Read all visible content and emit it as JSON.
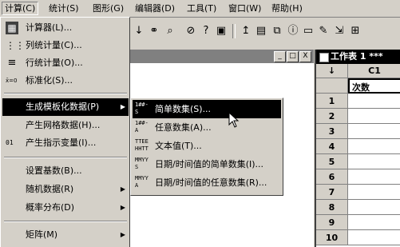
{
  "menubar": [
    {
      "label": "计算(C)",
      "active": true
    },
    {
      "label": "统计(S)"
    },
    {
      "label": "图形(G)"
    },
    {
      "label": "编辑器(D)"
    },
    {
      "label": "工具(T)"
    },
    {
      "label": "窗口(W)"
    },
    {
      "label": "帮助(H)"
    }
  ],
  "toolbar": {
    "icons": [
      "arrow-down-icon",
      "binoculars-icon",
      "find-icon",
      "cancel-icon",
      "help-icon",
      "book-icon",
      "cursor-icon",
      "window-icon",
      "window-stack-icon",
      "info-icon",
      "document-icon",
      "document-edit-icon",
      "export-icon",
      "grid-icon"
    ]
  },
  "doc_window": {
    "controls": [
      "_",
      "□",
      "X"
    ]
  },
  "calc_menu": {
    "items": [
      {
        "label": "计算器(L)...",
        "icon": "calculator-icon",
        "icon_glyph": "▦"
      },
      {
        "label": "列统计量(C)...",
        "icon": "column-stats-icon",
        "icon_glyph": "⋮⋮"
      },
      {
        "label": "行统计量(O)...",
        "icon": "row-stats-icon",
        "icon_glyph": "≡"
      },
      {
        "label": "标准化(S)...",
        "icon": "standardize-icon",
        "icon_glyph": "x̄=0"
      },
      {
        "separator": true
      },
      {
        "label": "生成模板化数据(P)",
        "submenu": true,
        "highlighted": true
      },
      {
        "label": "产生网格数据(H)..."
      },
      {
        "label": "产生指示变量(I)...",
        "icon": "indicator-icon",
        "icon_glyph": "01"
      },
      {
        "separator": true
      },
      {
        "label": "设置基数(B)..."
      },
      {
        "label": "随机数据(R)",
        "submenu": true
      },
      {
        "label": "概率分布(D)",
        "submenu": true
      },
      {
        "separator": true
      },
      {
        "label": "矩阵(M)",
        "submenu": true
      }
    ],
    "arrow": "▶"
  },
  "pattern_submenu": {
    "items": [
      {
        "label": "简单数集(S)...",
        "icon_top": "1##-",
        "icon_bottom": "S",
        "highlighted": true
      },
      {
        "label": "任意数集(A)...",
        "icon_top": "1##-",
        "icon_bottom": "A"
      },
      {
        "label": "文本值(T)...",
        "icon_top": "TTEE",
        "icon_bottom": "HHTT"
      },
      {
        "label": "日期/时间值的简单数集(I)...",
        "icon_top": "MMYY",
        "icon_bottom": "S"
      },
      {
        "label": "日期/时间值的任意数集(R)...",
        "icon_top": "MMYY",
        "icon_bottom": "A"
      }
    ]
  },
  "worksheet": {
    "title": "工作表 1 ***",
    "corner_arrow": "↓",
    "column_header": "C1",
    "column_name": "次数",
    "rows": [
      "1",
      "2",
      "3",
      "4",
      "5",
      "6",
      "7",
      "8",
      "9",
      "10"
    ]
  }
}
